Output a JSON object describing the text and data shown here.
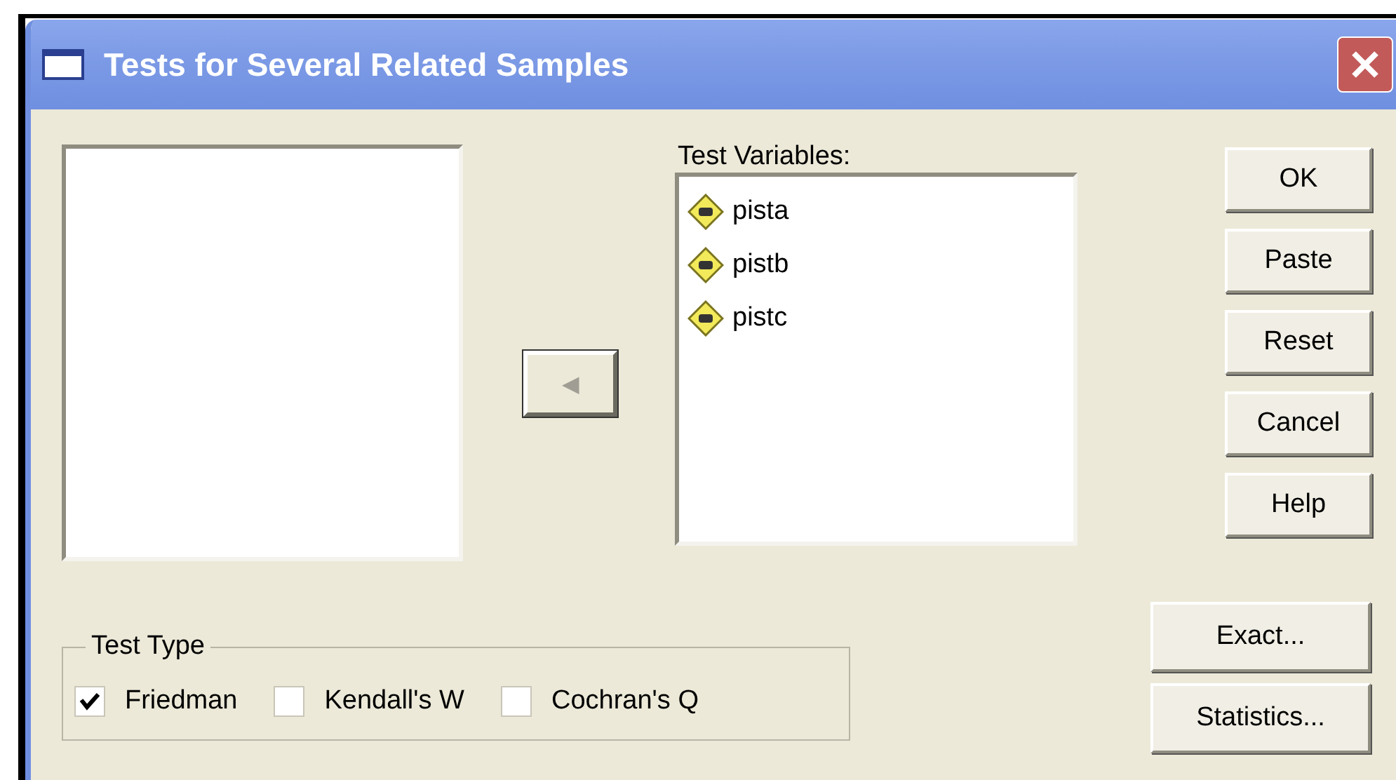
{
  "window": {
    "title": "Tests for Several Related Samples"
  },
  "move_button": {
    "label": "◀",
    "disabled": true
  },
  "test_variables": {
    "label": "Test Variables:",
    "items": [
      {
        "name": "pista"
      },
      {
        "name": "pistb"
      },
      {
        "name": "pistc"
      }
    ]
  },
  "buttons": [
    {
      "label": "OK"
    },
    {
      "label": "Paste"
    },
    {
      "label": "Reset"
    },
    {
      "label": "Cancel"
    },
    {
      "label": "Help"
    }
  ],
  "test_type": {
    "legend": "Test Type",
    "options": [
      {
        "label": "Friedman",
        "checked": true
      },
      {
        "label": "Kendall's W",
        "checked": false
      },
      {
        "label": "Cochran's Q",
        "checked": false
      }
    ]
  },
  "extra_buttons": [
    {
      "label": "Exact..."
    },
    {
      "label": "Statistics..."
    }
  ]
}
